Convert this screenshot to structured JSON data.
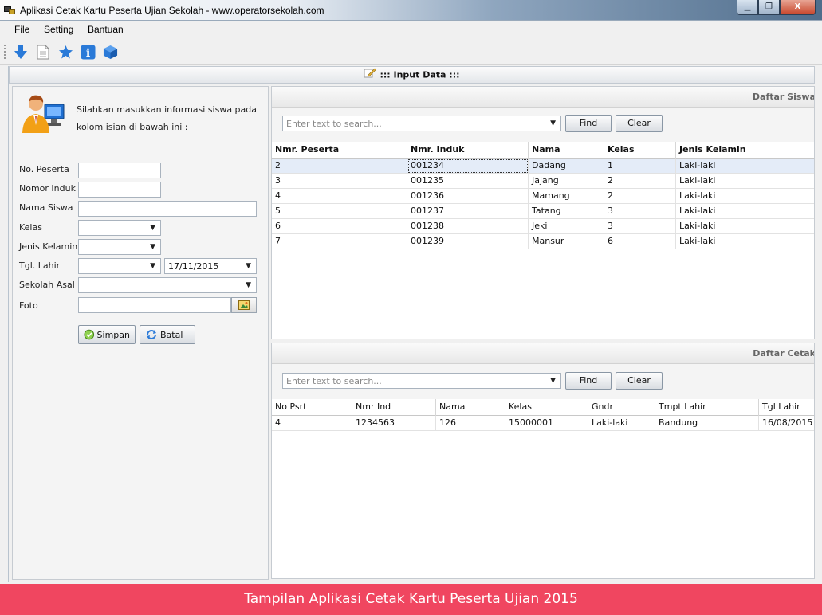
{
  "window": {
    "title": "Aplikasi Cetak Kartu Peserta Ujian Sekolah - www.operatorsekolah.com",
    "min_glyph": "▁",
    "max_glyph": "❐",
    "close_glyph": "X"
  },
  "menu": [
    "File",
    "Setting",
    "Bantuan"
  ],
  "toolbar": {
    "icons": [
      "download-arrow-icon",
      "document-icon",
      "star-icon",
      "info-icon",
      "cube-icon"
    ],
    "info_glyph": "i"
  },
  "main": {
    "header": "::: Input Data :::"
  },
  "form": {
    "intro": "Silahkan masukkan informasi siswa pada kolom isian di bawah ini :",
    "labels": {
      "no_peserta": "No. Peserta",
      "nomor_induk": "Nomor Induk",
      "nama_siswa": "Nama Siswa",
      "kelas": "Kelas",
      "jenis_kelamin": "Jenis Kelamin",
      "tgl_lahir": "Tgl. Lahir",
      "sekolah_asal": "Sekolah Asal",
      "foto": "Foto"
    },
    "values": {
      "no_peserta": "",
      "nomor_induk": "",
      "nama_siswa": "",
      "kelas": "",
      "jenis_kelamin": "",
      "tempat_lahir": "",
      "tgl_lahir": "17/11/2015",
      "sekolah_asal": "",
      "foto": ""
    },
    "buttons": {
      "simpan": "Simpan",
      "batal": "Batal"
    }
  },
  "daftar_siswa": {
    "title": "Daftar Siswa",
    "search_placeholder": "Enter text to search...",
    "find": "Find",
    "clear": "Clear",
    "columns": [
      "Nmr. Peserta",
      "Nmr. Induk",
      "Nama",
      "Kelas",
      "Jenis Kelamin"
    ],
    "rows": [
      [
        "2",
        "001234",
        "Dadang",
        "1",
        "Laki-laki"
      ],
      [
        "3",
        "001235",
        "Jajang",
        "2",
        "Laki-laki"
      ],
      [
        "4",
        "001236",
        "Mamang",
        "2",
        "Laki-laki"
      ],
      [
        "5",
        "001237",
        "Tatang",
        "3",
        "Laki-laki"
      ],
      [
        "6",
        "001238",
        "Jeki",
        "3",
        "Laki-laki"
      ],
      [
        "7",
        "001239",
        "Mansur",
        "6",
        "Laki-laki"
      ]
    ]
  },
  "daftar_cetak": {
    "title": "Daftar Cetak",
    "search_placeholder": "Enter text to search...",
    "find": "Find",
    "clear": "Clear",
    "columns": [
      "No Psrt",
      "Nmr Ind",
      "Nama",
      "Kelas",
      "Gndr",
      "Tmpt Lahir",
      "Tgl Lahir"
    ],
    "rows": [
      [
        "4",
        "1234563",
        "126",
        "15000001",
        "Laki-laki",
        "Bandung",
        "16/08/2015"
      ]
    ]
  },
  "banner": "Tampilan Aplikasi Cetak Kartu Peserta Ujian 2015",
  "colors": {
    "banner": "#f04660",
    "selected_row": "#e4ecf8",
    "toolbar_blue": "#2a7ad8"
  }
}
